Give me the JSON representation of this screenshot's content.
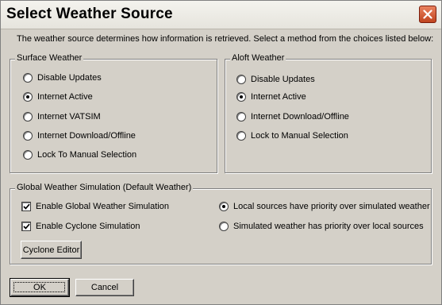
{
  "window": {
    "title": "Select Weather Source"
  },
  "intro_text": "The weather source determines how information is retrieved.  Select a method from the choices listed below:",
  "surface": {
    "legend": "Surface Weather",
    "options": [
      {
        "label": "Disable Updates",
        "selected": false
      },
      {
        "label": "Internet Active",
        "selected": true
      },
      {
        "label": "Internet VATSIM",
        "selected": false
      },
      {
        "label": "Internet Download/Offline",
        "selected": false
      },
      {
        "label": "Lock To Manual Selection",
        "selected": false
      }
    ]
  },
  "aloft": {
    "legend": "Aloft Weather",
    "options": [
      {
        "label": "Disable Updates",
        "selected": false
      },
      {
        "label": "Internet Active",
        "selected": true
      },
      {
        "label": "Internet Download/Offline",
        "selected": false
      },
      {
        "label": "Lock to Manual Selection",
        "selected": false
      }
    ]
  },
  "global": {
    "legend": "Global Weather Simulation (Default Weather)",
    "checkboxes": [
      {
        "label": "Enable Global Weather Simulation",
        "checked": true
      },
      {
        "label": "Enable Cyclone Simulation",
        "checked": true
      }
    ],
    "priority": [
      {
        "label": "Local sources have priority over simulated weather",
        "selected": true
      },
      {
        "label": "Simulated weather has priority over local sources",
        "selected": false
      }
    ],
    "cyclone_editor_label": "Cyclone Editor"
  },
  "buttons": {
    "ok_label": "OK",
    "cancel_label": "Cancel"
  }
}
